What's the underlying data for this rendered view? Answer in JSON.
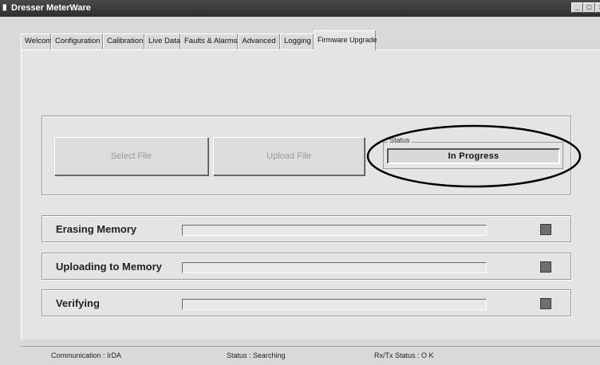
{
  "window": {
    "title": "Dresser MeterWare",
    "icon": "app-icon",
    "controls": [
      "_",
      "□",
      "×"
    ]
  },
  "tabs": [
    {
      "label": "Welcome",
      "active": false
    },
    {
      "label": "Configuration",
      "active": false
    },
    {
      "label": "Calibration",
      "active": false
    },
    {
      "label": "Live Data",
      "active": false
    },
    {
      "label": "Faults & Alarms",
      "active": false
    },
    {
      "label": "Advanced",
      "active": false
    },
    {
      "label": "Logging",
      "active": false
    },
    {
      "label": "Firmware Upgrade",
      "active": true
    }
  ],
  "actions": {
    "select_file": "Select File",
    "upload_file": "Upload File"
  },
  "status": {
    "legend": "Status",
    "value": "In Progress"
  },
  "steps": [
    {
      "label": "Erasing Memory",
      "progress": 0,
      "indicator_color": "#6e6e6e"
    },
    {
      "label": "Uploading to Memory",
      "progress": 0,
      "indicator_color": "#6e6e6e"
    },
    {
      "label": "Verifying",
      "progress": 0,
      "indicator_color": "#6e6e6e"
    }
  ],
  "statusbar": {
    "communication": "Communication : IrDA",
    "status": "Status : Searching",
    "rxtx": "Rx/Tx Status : O K"
  },
  "colors": {
    "highlight_ellipse": "#000000",
    "progress_fill": "#0a246a"
  }
}
